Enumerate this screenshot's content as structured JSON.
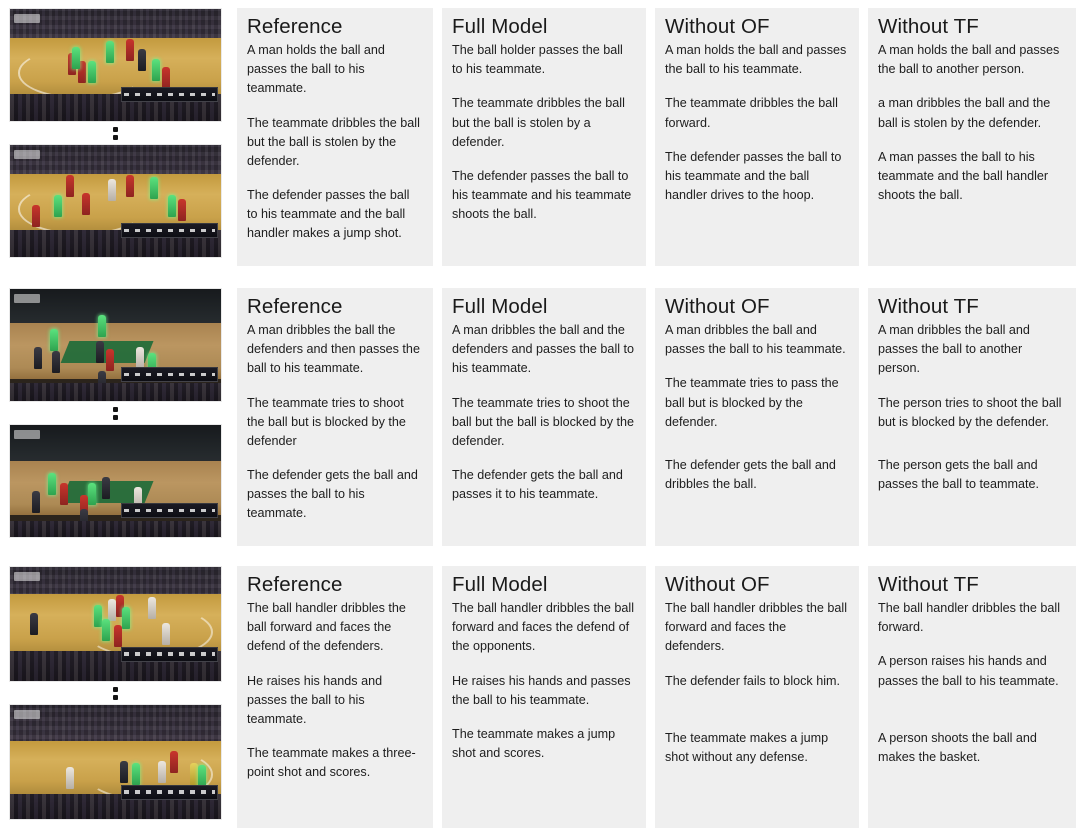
{
  "figure": {
    "type": "qualitative-comparison-grid",
    "column_headers": [
      "Reference",
      "Full Model",
      "Without OF",
      "Without TF"
    ],
    "rows": [
      {
        "row_id": "example-1",
        "video": {
          "frames": [
            {
              "frame_id": "row1-frame-top",
              "description": "Basketball broadcast frame: players in red and green highlighted jerseys on a yellow court, crowd behind, scorebug lower right"
            },
            {
              "frame_id": "row1-frame-bottom",
              "description": "Basketball broadcast frame: players spread across yellow court, one player driving left, crowd behind, scorebug lower right"
            }
          ],
          "separator": "vertical-ellipsis"
        },
        "columns": [
          {
            "header": "Reference",
            "sentences": [
              "A man holds the ball and passes the ball to his teammate.",
              "The teammate dribbles the ball but the ball is stolen by the defender.",
              "The defender passes the ball to his  teammate and the ball handler makes a jump shot."
            ]
          },
          {
            "header": "Full Model",
            "sentences": [
              "The ball holder passes the ball to his teammate.",
              "The teammate dribbles the ball but the ball is stolen by a defender.",
              "The defender passes the ball to his  teammate and his teammate shoots the ball."
            ]
          },
          {
            "header": "Without OF",
            "sentences": [
              "A man holds the ball and passes the ball to his teammate.",
              "The teammate dribbles the ball forward.",
              "The defender passes the ball to his  teammate and the ball handler drives to the hoop."
            ]
          },
          {
            "header": "Without TF",
            "sentences": [
              "A man holds the ball and passes the ball to another person.",
              "a man dribbles the ball and the ball is stolen by the defender.",
              "A man passes the ball to his  teammate and the ball handler shoots the ball."
            ]
          }
        ]
      },
      {
        "row_id": "example-2",
        "video": {
          "frames": [
            {
              "frame_id": "row2-frame-top",
              "description": "Basketball broadcast frame: dark arena, green painted key, players in green and dark jerseys on tan court"
            },
            {
              "frame_id": "row2-frame-bottom",
              "description": "Basketball broadcast frame: dark arena, green painted key, cluster of players near the paint"
            }
          ],
          "separator": "vertical-ellipsis"
        },
        "columns": [
          {
            "header": "Reference",
            "sentences": [
              "A man dribbles the ball  the defenders and then passes the ball to his teammate.",
              "The teammate tries to shoot the ball but is blocked by the defender",
              "The defender gets the ball and passes the ball to his teammate."
            ]
          },
          {
            "header": "Full Model",
            "sentences": [
              "A man dribbles the ball and the defenders and passes the ball to his teammate.",
              "The teammate tries to shoot the ball but the ball is blocked by the defender.",
              "The defender gets the ball and passes it  to his teammate."
            ]
          },
          {
            "header": "Without OF",
            "sentences": [
              "A man dribbles the ball and passes the ball to his teammate.",
              "The teammate tries to pass the ball but is blocked by the defender.",
              "The defender gets the ball and dribbles the ball."
            ]
          },
          {
            "header": "Without TF",
            "sentences": [
              "A man dribbles the ball and passes the ball to another person.",
              "The person tries to shoot the ball but is blocked by the defender.",
              "The person gets the ball and passes the ball to teammate."
            ]
          }
        ]
      },
      {
        "row_id": "example-3",
        "video": {
          "frames": [
            {
              "frame_id": "row3-frame-top",
              "description": "Basketball broadcast frame: cluster of players in green and white jerseys near the top of the key on a yellow court"
            },
            {
              "frame_id": "row3-frame-bottom",
              "description": "Basketball broadcast frame: players spread out on a yellow court with the three-point arc visible, crowd behind"
            }
          ],
          "separator": "vertical-ellipsis"
        },
        "columns": [
          {
            "header": "Reference",
            "sentences": [
              "The ball  handler dribbles the ball forward and faces the defend of the defenders.",
              "He raises his hands and passes the ball to his teammate.",
              "The teammate makes a three-point shot and scores."
            ]
          },
          {
            "header": "Full Model",
            "sentences": [
              "The ball handler dribbles the ball forward and faces the defend of the opponents.",
              "He raises his hands and passes the ball to his teammate.",
              "The teammate makes  a jump shot and scores."
            ]
          },
          {
            "header": "Without OF",
            "sentences": [
              "The ball handler dribbles the ball forward and faces the defenders.",
              "The defender fails to block him.",
              "The teammate makes a jump shot without any defense."
            ]
          },
          {
            "header": "Without TF",
            "sentences": [
              "The ball handler dribbles the ball forward.",
              "A person raises his hands and passes the ball to his teammate.",
              "A person shoots the ball and makes the basket."
            ]
          }
        ]
      }
    ],
    "colors": {
      "panel_background": "#efefef",
      "page_background": "#ffffff",
      "text": "#1d1d1d",
      "title_text": "#1a1a1a"
    }
  }
}
